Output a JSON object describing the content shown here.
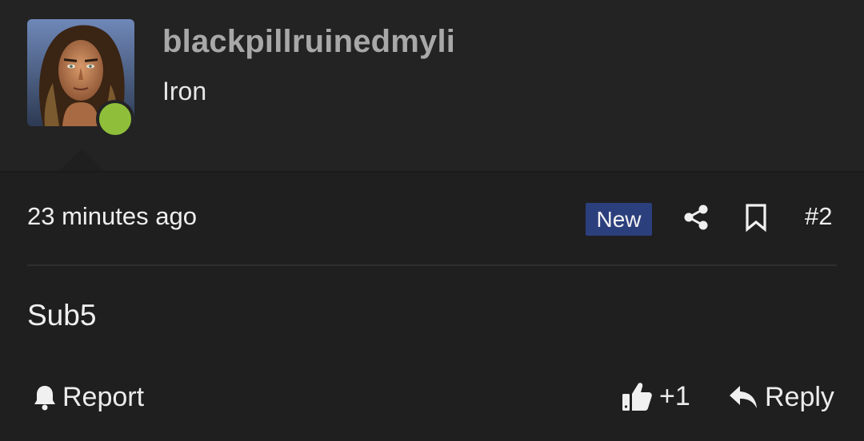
{
  "user": {
    "username": "blackpillruinedmyli",
    "title": "Iron",
    "online": true,
    "online_color": "#8fbf3a"
  },
  "meta": {
    "timestamp": "23 minutes ago",
    "badge": "New",
    "badge_color": "#2c3f7d",
    "post_number": "#2",
    "icons": [
      "share-icon",
      "bookmark-icon"
    ]
  },
  "post": {
    "body": "Sub5"
  },
  "actions": {
    "report_label": "Report",
    "like_label": "+1",
    "reply_label": "Reply",
    "icons": [
      "bell-icon",
      "thumbs-up-icon",
      "reply-arrow-icon"
    ]
  }
}
